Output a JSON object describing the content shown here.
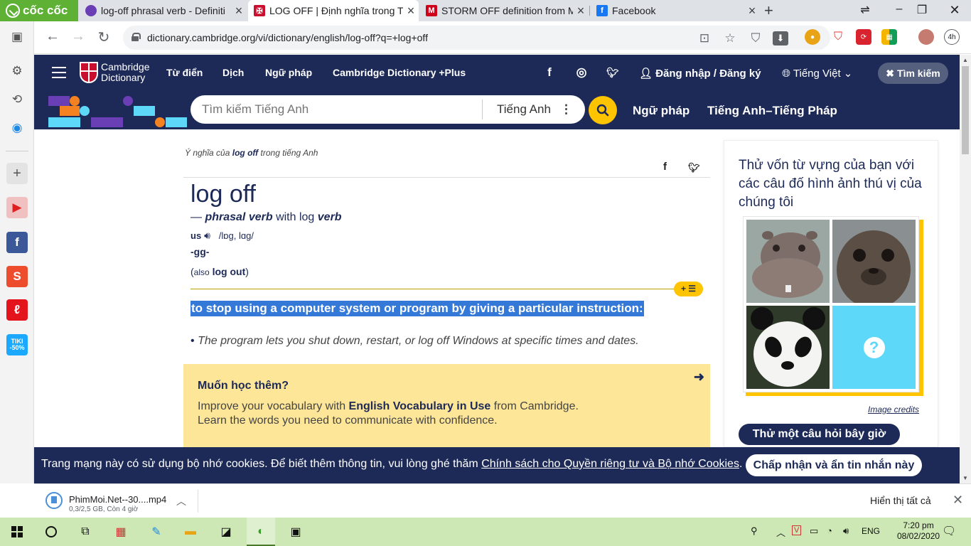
{
  "browser": {
    "brand_label": "cốc cốc",
    "tabs": [
      {
        "title": "log-off phrasal verb - Definiti",
        "favicon_color": "#6a3fb5",
        "active": false
      },
      {
        "title": "LOG OFF | Định nghĩa trong T",
        "favicon_color": "#c8102e",
        "active": true
      },
      {
        "title": "STORM OFF definition from M",
        "favicon_color": "#d0021b",
        "active": false
      },
      {
        "title": "Facebook",
        "favicon_color": "#1877f2",
        "active": false
      }
    ],
    "url": "dictionary.cambridge.org/vi/dictionary/english/log-off?q=+log+off",
    "extension_badge": "4h"
  },
  "site_header": {
    "logo_line1": "Cambridge",
    "logo_line2": "Dictionary",
    "nav": [
      "Từ điển",
      "Dịch",
      "Ngữ pháp",
      "Cambridge Dictionary +Plus"
    ],
    "login": "Đăng nhập / Đăng ký",
    "language": "Tiếng Việt",
    "search_button": "Tìm kiếm"
  },
  "search_bar": {
    "placeholder": "Tìm kiếm Tiếng Anh",
    "dictionary": "Tiếng Anh",
    "links": [
      "Ngữ pháp",
      "Tiếng Anh–Tiếng Pháp"
    ]
  },
  "entry": {
    "crumb_prefix": "Ý nghĩa của",
    "crumb_word": "log off",
    "crumb_suffix": "trong tiếng Anh",
    "headword": "log off",
    "pos_dash": "—",
    "pos": "phrasal verb",
    "pos_with": "with log",
    "pos_verb": "verb",
    "region": "us",
    "ipa": "/lɒɡ, lɑɡ/",
    "grammar": "-gg-",
    "also_open": "(",
    "also_label": "also",
    "also_word": "log out",
    "also_close": ")",
    "add_list_label": "+ ☰",
    "definition": "to stop using a computer system or program by giving a particular instruction:",
    "example_bullet": "•",
    "example": "The program lets you shut down, restart, or log off Windows at specific times and dates."
  },
  "learn_more": {
    "title": "Muốn học thêm?",
    "line1_pre": "Improve your vocabulary with",
    "line1_bold": "English Vocabulary in Use",
    "line1_post": "from Cambridge.",
    "line2": "Learn the words you need to communicate with confidence."
  },
  "quiz": {
    "title": "Thử vốn từ vựng của bạn với các câu đố hình ảnh thú vị của chúng tôi",
    "images": [
      "hippo",
      "seal",
      "panda",
      "question"
    ],
    "credits": "Image credits",
    "button": "Thử một câu hỏi bây giờ"
  },
  "cookie": {
    "text": "Trang mạng này có sử dụng bộ nhớ cookies. Để biết thêm thông tin, vui lòng ghé thăm",
    "link": "Chính sách cho Quyền riêng tư và Bộ nhớ Cookies",
    "end": ".",
    "button": "Chấp nhận và ẩn tin nhắn này"
  },
  "download": {
    "file": "PhimMoi.Net--30....mp4",
    "status": "0,3/2,5 GB, Còn 4 giờ",
    "show_all": "Hiển thị tất cả"
  },
  "taskbar": {
    "language": "ENG",
    "time": "7:20 pm",
    "date": "08/02/2020"
  },
  "colors": {
    "cambridge_navy": "#1d2a57",
    "accent_yellow": "#fec400",
    "highlight_blue": "#3478d8",
    "learn_bg": "#fee698",
    "taskbar_green": "#cde8b5",
    "brand_green": "#5fb136"
  }
}
